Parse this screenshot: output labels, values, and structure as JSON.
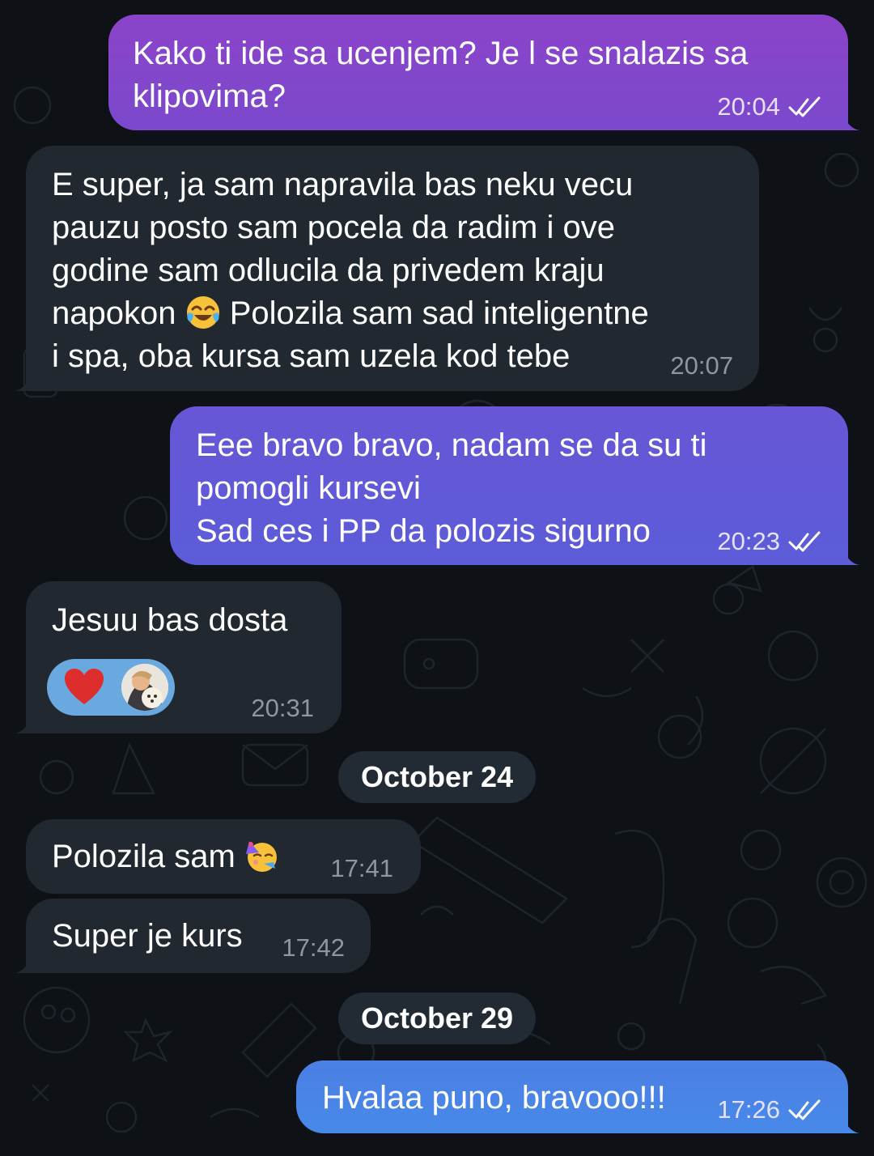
{
  "messages": [
    {
      "text": "Kako ti ide sa ucenjem? Je l se snalazis sa\nklipovima?",
      "time": "20:04",
      "status": "read-double-check"
    },
    {
      "text_before_emoji": "E super, ja sam napravila bas neku vecu\npauzu posto sam pocela da radim i ove\ngodine sam odlucila da privedem kraju\nnapokon ",
      "emoji": "face-with-tears-of-joy",
      "text_after_emoji": " Polozila sam sad inteligentne\ni spa, oba kursa sam uzela kod tebe",
      "time": "20:07"
    },
    {
      "text": "Eee bravo bravo, nadam se da su ti\npomogli kursevi\nSad ces i PP da polozis sigurno",
      "time": "20:23",
      "status": "read-double-check"
    },
    {
      "text": "Jesuu bas dosta",
      "time": "20:31",
      "reaction": {
        "emoji": "red-heart",
        "by": "user-avatar"
      }
    },
    {
      "text": "Polozila sam ",
      "emoji": "partying-face",
      "time": "17:41"
    },
    {
      "text": "Super je kurs",
      "time": "17:42"
    },
    {
      "text": "Hvalaa puno, bravooo!!!",
      "time": "17:26",
      "status": "read-double-check"
    }
  ],
  "date_separators": [
    "October 24",
    "October 29"
  ],
  "colors": {
    "background": "#0e1115",
    "incoming_bubble": "#212830",
    "outgoing_gradient": [
      "#8a45c9",
      "#6f52d3",
      "#5d60da",
      "#4a86e8"
    ],
    "reaction_bg": "#69a9e0",
    "heart": "#dd2d2d"
  }
}
